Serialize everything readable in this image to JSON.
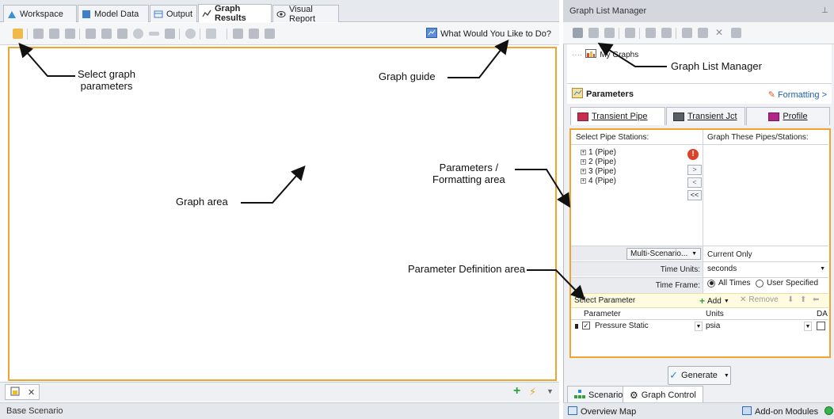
{
  "left_tabs": [
    {
      "label": "Workspace",
      "icon": "workspace-icon"
    },
    {
      "label": "Model Data",
      "icon": "model-data-icon"
    },
    {
      "label": "Output",
      "icon": "output-icon"
    },
    {
      "label": "Graph Results",
      "icon": "graph-results-icon"
    },
    {
      "label": "Visual Report",
      "icon": "visual-report-icon"
    }
  ],
  "toolbar": {
    "help_label": "What Would You Like to Do?"
  },
  "left_status": {
    "scenario": "Base Scenario"
  },
  "glm": {
    "title": "Graph List Manager",
    "tree_root": "My Graphs"
  },
  "params": {
    "title": "Parameters",
    "formatting_label": "Formatting >",
    "tabs": [
      "Transient Pipe",
      "Transient Jct",
      "Profile"
    ],
    "select_stations_header": "Select Pipe Stations:",
    "graph_these_header": "Graph These Pipes/Stations:",
    "stations": [
      "1 (Pipe)",
      "2 (Pipe)",
      "3 (Pipe)",
      "4 (Pipe)"
    ],
    "move_buttons": [
      ">",
      "<",
      "<<"
    ],
    "multi_scenario_label": "Multi-Scenario...",
    "current_only_label": "Current Only",
    "time_units_label": "Time Units:",
    "time_units_value": "seconds",
    "time_frame_label": "Time Frame:",
    "time_frame_options": [
      "All Times",
      "User Specified"
    ],
    "select_parameter_label": "Select Parameter",
    "add_label": "Add",
    "remove_label": "Remove",
    "table_headers": [
      "Parameter",
      "Units",
      "DA"
    ],
    "row": {
      "parameter": "Pressure Static",
      "units": "psia"
    }
  },
  "generate_label": "Generate",
  "bottom_tabs": [
    "Scenario",
    "Graph Control"
  ],
  "right_status": {
    "overview": "Overview Map",
    "addon": "Add-on Modules"
  },
  "annotations": {
    "select_graph_params": "Select graph\nparameters",
    "graph_guide": "Graph guide",
    "graph_list_manager": "Graph List Manager",
    "graph_area": "Graph area",
    "params_formatting": "Parameters /\nFormatting area",
    "param_def_area": "Parameter Definition area"
  },
  "colors": {
    "highlight": "#f0a430",
    "accent_link": "#1b5fb1"
  }
}
